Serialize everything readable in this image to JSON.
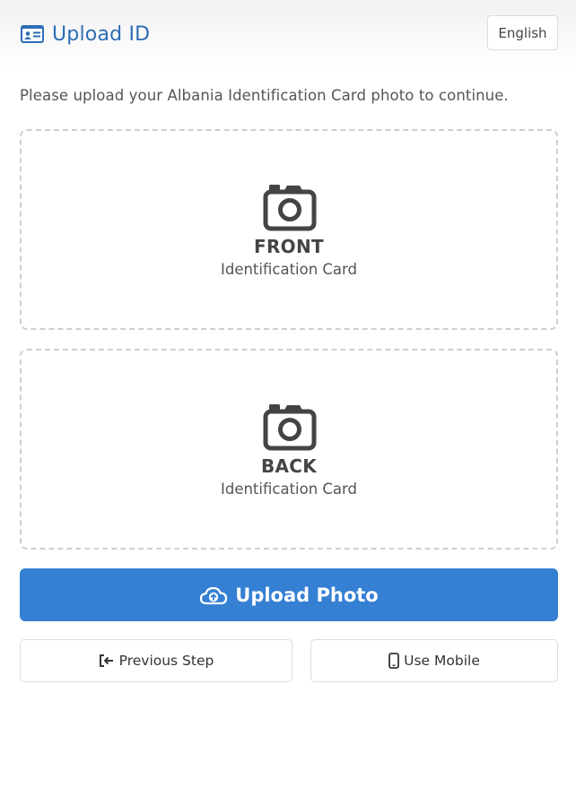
{
  "header": {
    "title": "Upload ID",
    "title_icon": "id-card-icon",
    "language_label": "English"
  },
  "instructions": "Please upload your Albania Identification Card photo to continue.",
  "upload_boxes": [
    {
      "side": "FRONT",
      "subtitle": "Identification Card",
      "icon": "camera-icon"
    },
    {
      "side": "BACK",
      "subtitle": "Identification Card",
      "icon": "camera-icon"
    }
  ],
  "actions": {
    "upload_label": "Upload Photo",
    "upload_icon": "cloud-upload-icon",
    "previous_label": "Previous Step",
    "previous_icon": "sign-out-arrow-icon",
    "mobile_label": "Use Mobile",
    "mobile_icon": "mobile-phone-icon"
  },
  "colors": {
    "brand": "#2d6db5",
    "primary_button": "#3580d3",
    "icon_dark": "#444444",
    "dashed_border": "#cfcfcf"
  }
}
